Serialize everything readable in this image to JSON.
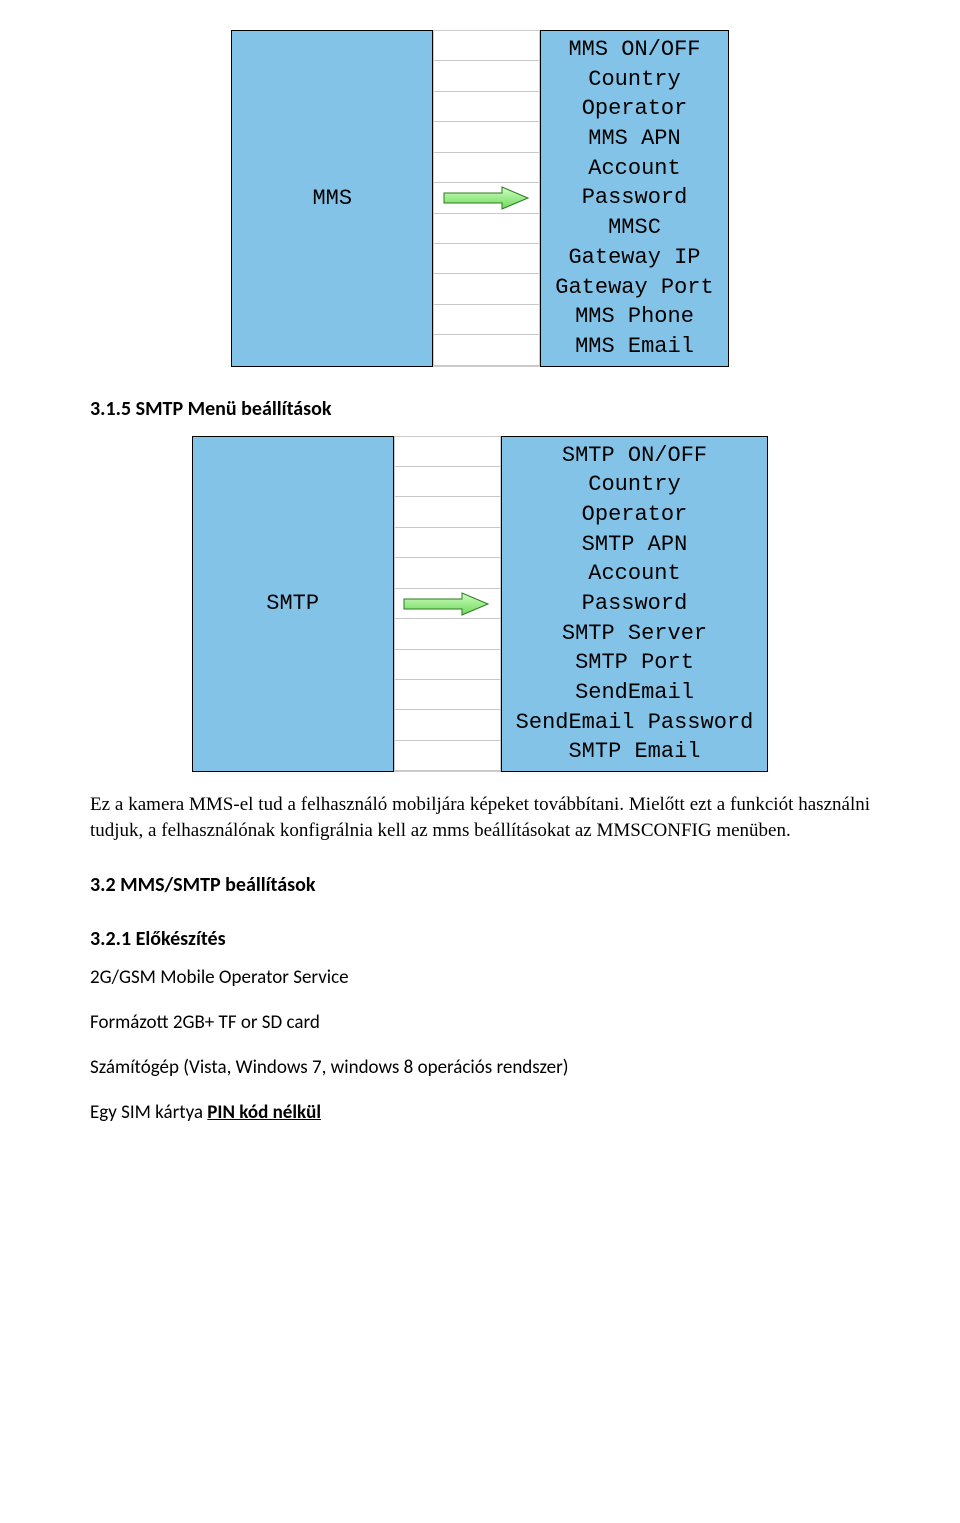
{
  "mms_diagram": {
    "left_label": "MMS",
    "right_items": [
      "MMS ON/OFF",
      "Country",
      "Operator",
      "MMS APN",
      "Account",
      "Password",
      "MMSC",
      "Gateway IP",
      "Gateway Port",
      "MMS Phone",
      "MMS Email"
    ]
  },
  "heading_315": "3.1.5 SMTP Menü beállítások",
  "smtp_diagram": {
    "left_label": "SMTP",
    "right_items": [
      "SMTP ON/OFF",
      "Country",
      "Operator",
      "SMTP APN",
      "Account",
      "Password",
      "SMTP Server",
      "SMTP Port",
      "SendEmail",
      "SendEmail Password",
      "SMTP Email"
    ]
  },
  "paragraph_intro": "Ez a kamera MMS-el tud a felhasználó mobiljára képeket továbbítani. Mielőtt ezt a funkciót használni tudjuk, a felhasználónak konfigrálnia kell az mms beállításokat az MMSCONFIG menüben.",
  "heading_32": "3.2 MMS/SMTP beállítások",
  "heading_321": "3.2.1 Előkészítés",
  "item1": "2G/GSM Mobile Operator Service",
  "item2": "Formázott 2GB+ TF or SD card",
  "item3": "Számítógép (Vista, Windows 7, windows 8 operációs rendszer)",
  "item4_prefix": "Egy SIM kártya ",
  "item4_bold": "PIN kód nélkül"
}
